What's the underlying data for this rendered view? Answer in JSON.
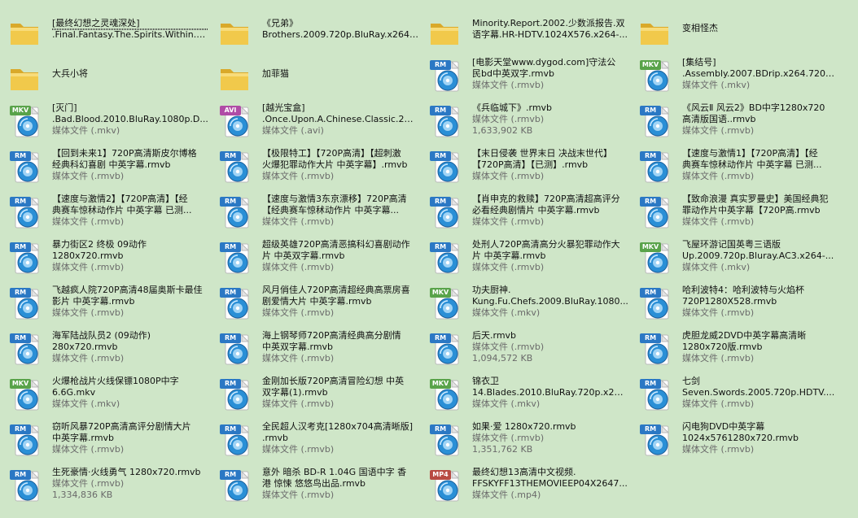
{
  "colors": {
    "background": "#cfe6c8",
    "folder": "#f1c94b",
    "rm_badge": "#2b78c4",
    "mkv_badge": "#59a34a",
    "avi_badge": "#b04ca6",
    "mp4_badge": "#b84a42",
    "media_disc": "#2a8fd6"
  },
  "items": [
    {
      "type": "folder",
      "line1": "[最终幻想之灵魂深处]",
      "line2": ".Final.Fantasy.The.Spirits.Within.2...",
      "selected": true
    },
    {
      "type": "folder",
      "line1": "《兄弟》",
      "line2": "Brothers.2009.720p.BluRay.x264-..."
    },
    {
      "type": "folder",
      "line1": "Minority.Report.2002.少数派报告.双",
      "line2": "语字幕.HR-HDTV.1024X576.x264-..."
    },
    {
      "type": "folder",
      "line1": "变相怪杰"
    },
    {
      "type": "folder",
      "line1": "大兵小将"
    },
    {
      "type": "folder",
      "line1": "加菲猫"
    },
    {
      "type": "file",
      "badge": "RM",
      "line1": "[电影天堂www.dygod.com]守法公",
      "line2": "民bd中英双字.rmvb",
      "line3": "媒体文件 (.rmvb)"
    },
    {
      "type": "file",
      "badge": "MKV",
      "line1": "[集结号]",
      "line2": ".Assembly.2007.BDrip.x264.720p....",
      "line3": "媒体文件 (.mkv)"
    },
    {
      "type": "file",
      "badge": "MKV",
      "line1": "[灭门]",
      "line2": ".Bad.Blood.2010.BluRay.1080p.D...",
      "line3": "媒体文件 (.mkv)"
    },
    {
      "type": "file",
      "badge": "AVI",
      "line1": "[越光宝盒]",
      "line2": ".Once.Upon.A.Chinese.Classic.201...",
      "line3": "媒体文件 (.avi)"
    },
    {
      "type": "file",
      "badge": "RM",
      "line1": "《兵临城下》.rmvb",
      "line2": "媒体文件 (.rmvb)",
      "line3": "1,633,902 KB"
    },
    {
      "type": "file",
      "badge": "RM",
      "line1": "《风云Ⅱ 风云2》BD中字1280x720",
      "line2": "高清版国语..rmvb",
      "line3": "媒体文件 (.rmvb)"
    },
    {
      "type": "file",
      "badge": "RM",
      "line1": "【回到未来1】720P高清斯皮尔博格",
      "line2": "经典科幻喜剧 中英字幕.rmvb",
      "line3": "媒体文件 (.rmvb)"
    },
    {
      "type": "file",
      "badge": "RM",
      "line1": "【极限特工】【720P高清】【超刺激",
      "line2": "火爆犯罪动作大片 中英字幕】.rmvb",
      "line3": "媒体文件 (.rmvb)"
    },
    {
      "type": "file",
      "badge": "RM",
      "line1": "【末日侵袭 世界末日 决战末世代】",
      "line2": "【720P高清】【已测】.rmvb",
      "line3": "媒体文件 (.rmvb)"
    },
    {
      "type": "file",
      "badge": "RM",
      "line1": "【速度与激情1】【720P高清】【经",
      "line2": "典赛车惊秫动作片 中英字幕 已测...",
      "line3": "媒体文件 (.rmvb)"
    },
    {
      "type": "file",
      "badge": "RM",
      "line1": "【速度与激情2】【720P高清】【经",
      "line2": "典赛车惊秫动作片 中英字幕 已测...",
      "line3": "媒体文件 (.rmvb)"
    },
    {
      "type": "file",
      "badge": "RM",
      "line1": "【速度与激情3东京漂移】720P高清",
      "line2": "【经典赛车惊秫动作片 中英字幕...",
      "line3": "媒体文件 (.rmvb)"
    },
    {
      "type": "file",
      "badge": "RM",
      "line1": "【肖申克的救赎】720P高清超高评分",
      "line2": "必看经典剧情片 中英字幕.rmvb",
      "line3": "媒体文件 (.rmvb)"
    },
    {
      "type": "file",
      "badge": "RM",
      "line1": "【致命浪漫 真实罗曼史】美国经典犯",
      "line2": "罪动作片中英字幕【720P高.rmvb",
      "line3": "媒体文件 (.rmvb)"
    },
    {
      "type": "file",
      "badge": "RM",
      "line1": "暴力街区2 终极 09动作",
      "line2": "1280x720.rmvb",
      "line3": "媒体文件 (.rmvb)"
    },
    {
      "type": "file",
      "badge": "RM",
      "line1": "超级英雄720P高清恶搞科幻喜剧动作",
      "line2": "片 中英双字幕.rmvb",
      "line3": "媒体文件 (.rmvb)"
    },
    {
      "type": "file",
      "badge": "RM",
      "line1": "处刑人720P高清高分火暴犯罪动作大",
      "line2": "片 中英字幕.rmvb",
      "line3": "媒体文件 (.rmvb)"
    },
    {
      "type": "file",
      "badge": "MKV",
      "line1": "飞屋环游记国英粤三语版",
      "line2": "Up.2009.720p.Bluray.AC3.x264-...",
      "line3": "媒体文件 (.mkv)"
    },
    {
      "type": "file",
      "badge": "RM",
      "line1": "飞越疯人院720P高清48届奥斯卡最佳",
      "line2": "影片 中英字幕.rmvb",
      "line3": "媒体文件 (.rmvb)"
    },
    {
      "type": "file",
      "badge": "RM",
      "line1": "风月俏佳人720P高清超经典高票房喜",
      "line2": "剧爱情大片 中英字幕.rmvb",
      "line3": "媒体文件 (.rmvb)"
    },
    {
      "type": "file",
      "badge": "MKV",
      "line1": "功夫厨神.",
      "line2": "Kung.Fu.Chefs.2009.BluRay.1080...",
      "line3": "媒体文件 (.mkv)"
    },
    {
      "type": "file",
      "badge": "RM",
      "line1": "哈利波特4：哈利波特与火焰杯",
      "line2": "720P1280X528.rmvb",
      "line3": "媒体文件 (.rmvb)"
    },
    {
      "type": "file",
      "badge": "RM",
      "line1": "海军陆战队员2 (09动作)",
      "line2": "280x720.rmvb",
      "line3": "媒体文件 (.rmvb)"
    },
    {
      "type": "file",
      "badge": "RM",
      "line1": "海上钢琴师720P高清经典高分剧情",
      "line2": "中英双字幕.rmvb",
      "line3": "媒体文件 (.rmvb)"
    },
    {
      "type": "file",
      "badge": "RM",
      "line1": "后天.rmvb",
      "line2": "媒体文件 (.rmvb)",
      "line3": "1,094,572 KB"
    },
    {
      "type": "file",
      "badge": "RM",
      "line1": "虎胆龙威2DVD中英字幕高清晰",
      "line2": "1280x720版.rmvb",
      "line3": "媒体文件 (.rmvb)"
    },
    {
      "type": "file",
      "badge": "MKV",
      "line1": "火爆枪战片火线保镖1080P中字",
      "line2": "6.6G.mkv",
      "line3": "媒体文件 (.mkv)"
    },
    {
      "type": "file",
      "badge": "RM",
      "line1": "金刚加长版720P高清冒险幻想 中英",
      "line2": "双字幕(1).rmvb",
      "line3": "媒体文件 (.rmvb)"
    },
    {
      "type": "file",
      "badge": "MKV",
      "line1": "锦衣卫",
      "line2": "14.Blades.2010.BluRay.720p.x264...",
      "line3": "媒体文件 (.mkv)"
    },
    {
      "type": "file",
      "badge": "RM",
      "line1": "七剑",
      "line2": "Seven.Swords.2005.720p.HDTV....",
      "line3": "媒体文件 (.rmvb)"
    },
    {
      "type": "file",
      "badge": "RM",
      "line1": "窃听风暴720P高清高评分剧情大片",
      "line2": "中英字幕.rmvb",
      "line3": "媒体文件 (.rmvb)"
    },
    {
      "type": "file",
      "badge": "RM",
      "line1": "全民超人汉考克[1280x704高清晰版]",
      "line2": ".rmvb",
      "line3": "媒体文件 (.rmvb)"
    },
    {
      "type": "file",
      "badge": "RM",
      "line1": "如果·爱 1280x720.rmvb",
      "line2": "媒体文件 (.rmvb)",
      "line3": "1,351,762 KB"
    },
    {
      "type": "file",
      "badge": "RM",
      "line1": "闪电狗DVD中英字幕",
      "line2": "1024x5761280x720.rmvb",
      "line3": "媒体文件 (.rmvb)"
    },
    {
      "type": "file",
      "badge": "RM",
      "line1": "生死豪情·火线勇气 1280x720.rmvb",
      "line2": "媒体文件 (.rmvb)",
      "line3": "1,334,836 KB"
    },
    {
      "type": "file",
      "badge": "RM",
      "line1": "意外 暗杀 BD-R 1.04G 国语中字 香",
      "line2": "港 惊悚 悠悠鸟出品.rmvb",
      "line3": "媒体文件 (.rmvb)"
    },
    {
      "type": "file",
      "badge": "MP4",
      "line1": "最终幻想13高清中文视频.",
      "line2": "FFSKYFF13THEMOVIEEP04X2647...",
      "line3": "媒体文件 (.mp4)"
    }
  ]
}
